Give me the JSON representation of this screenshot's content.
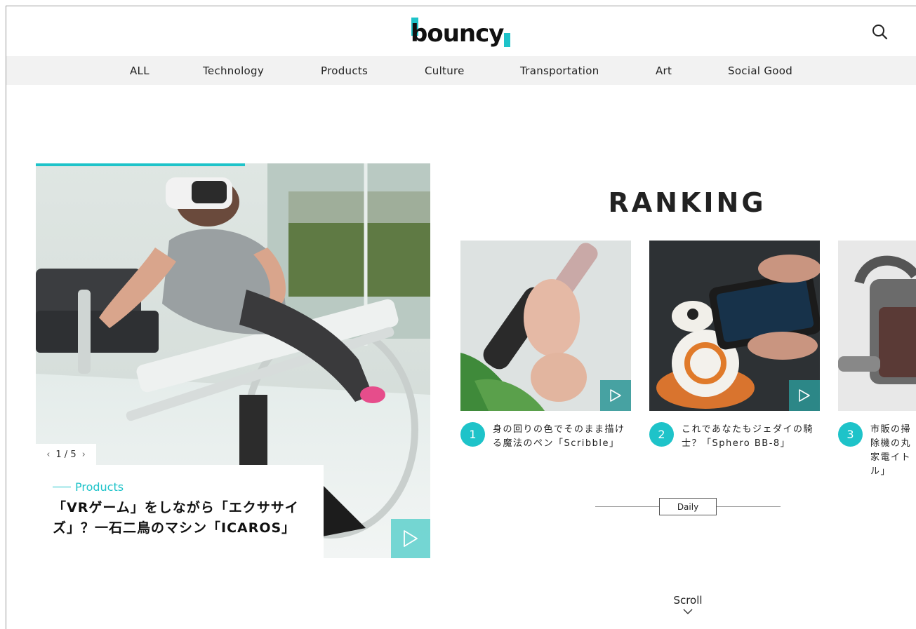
{
  "header": {
    "logo_text": "bouncy",
    "search_icon": "search-icon"
  },
  "nav": {
    "items": [
      {
        "label": "ALL"
      },
      {
        "label": "Technology"
      },
      {
        "label": "Products"
      },
      {
        "label": "Culture"
      },
      {
        "label": "Transportation"
      },
      {
        "label": "Art"
      },
      {
        "label": "Social Good"
      }
    ]
  },
  "hero": {
    "slide_counter": "1 / 5",
    "prev_icon": "chevron-left-icon",
    "next_icon": "chevron-right-icon",
    "category": "Products",
    "title": "「VRゲーム」をしながら「エクササイズ」？一石二鳥のマシン「ICAROS」",
    "progress": 0.53,
    "play_icon": "play-icon"
  },
  "ranking": {
    "title": "RANKING",
    "items": [
      {
        "rank": "1",
        "text": "身の回りの色でそのまま描ける魔法のペン「Scribble」"
      },
      {
        "rank": "2",
        "text": "これであなたもジェダイの騎士？「Sphero BB-8」"
      },
      {
        "rank": "3",
        "text": "市販の掃除機の丸家電イトル」"
      }
    ],
    "period_label": "Daily"
  },
  "scroll": {
    "label": "Scroll"
  },
  "colors": {
    "accent": "#1ec3c9",
    "nav_bg": "#f2f2f2"
  }
}
